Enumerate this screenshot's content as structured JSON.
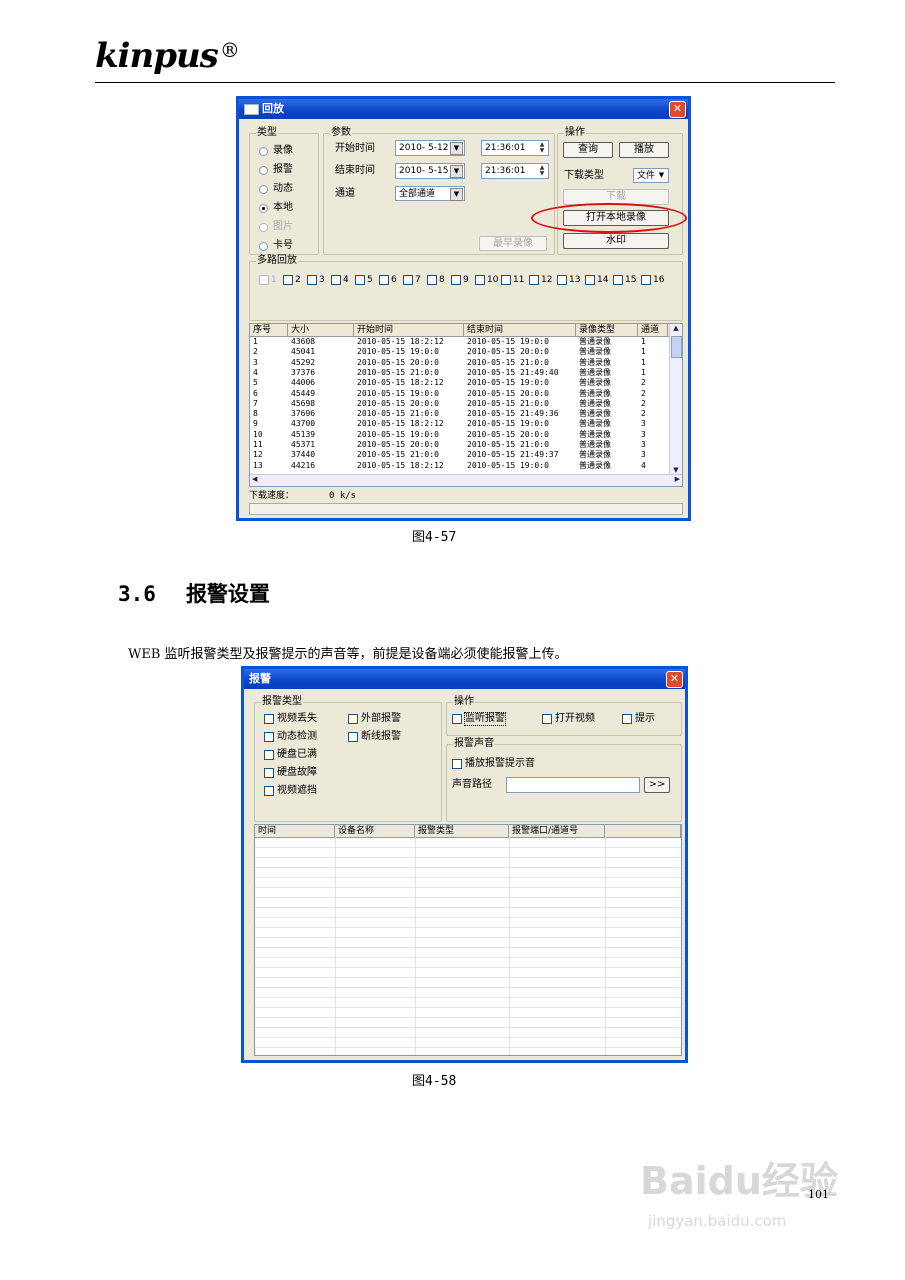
{
  "header": {
    "brand": "kinpus",
    "reg": "®"
  },
  "pb": {
    "title": "回放",
    "type_group": "类型",
    "types": [
      {
        "label": "录像",
        "on": false,
        "dis": false
      },
      {
        "label": "报警",
        "on": false,
        "dis": false
      },
      {
        "label": "动态",
        "on": false,
        "dis": false
      },
      {
        "label": "本地",
        "on": true,
        "dis": false
      },
      {
        "label": "图片",
        "on": false,
        "dis": true
      },
      {
        "label": "卡号",
        "on": false,
        "dis": false
      }
    ],
    "param_group": "参数",
    "start_label": "开始时间",
    "start_date": "2010- 5-12",
    "start_time": "21:36:01",
    "end_label": "结束时间",
    "end_date": "2010- 5-15",
    "end_time": "21:36:01",
    "channel_label": "通道",
    "channel_value": "全部通道",
    "earliest_btn": "最早录像",
    "op_group": "操作",
    "query_btn": "查询",
    "play_btn": "播放",
    "dl_type_label": "下载类型",
    "dl_type_value": "文件",
    "download_btn": "下载",
    "open_local_btn": "打开本地录像",
    "watermark_btn": "水印",
    "multi_group": "多路回放",
    "multi": [
      "1",
      "2",
      "3",
      "4",
      "5",
      "6",
      "7",
      "8",
      "9",
      "10",
      "11",
      "12",
      "13",
      "14",
      "15",
      "16"
    ],
    "columns": [
      "序号",
      "大小",
      "开始时间",
      "结束时间",
      "录像类型",
      "通道"
    ],
    "rows": [
      [
        "1",
        "43608",
        "2010-05-15 18:2:12",
        "2010-05-15 19:0:0",
        "普通录像",
        "1"
      ],
      [
        "2",
        "45041",
        "2010-05-15 19:0:0",
        "2010-05-15 20:0:0",
        "普通录像",
        "1"
      ],
      [
        "3",
        "45292",
        "2010-05-15 20:0:0",
        "2010-05-15 21:0:0",
        "普通录像",
        "1"
      ],
      [
        "4",
        "37376",
        "2010-05-15 21:0:0",
        "2010-05-15 21:49:40",
        "普通录像",
        "1"
      ],
      [
        "5",
        "44006",
        "2010-05-15 18:2:12",
        "2010-05-15 19:0:0",
        "普通录像",
        "2"
      ],
      [
        "6",
        "45449",
        "2010-05-15 19:0:0",
        "2010-05-15 20:0:0",
        "普通录像",
        "2"
      ],
      [
        "7",
        "45698",
        "2010-05-15 20:0:0",
        "2010-05-15 21:0:0",
        "普通录像",
        "2"
      ],
      [
        "8",
        "37696",
        "2010-05-15 21:0:0",
        "2010-05-15 21:49:36",
        "普通录像",
        "2"
      ],
      [
        "9",
        "43700",
        "2010-05-15 18:2:12",
        "2010-05-15 19:0:0",
        "普通录像",
        "3"
      ],
      [
        "10",
        "45139",
        "2010-05-15 19:0:0",
        "2010-05-15 20:0:0",
        "普通录像",
        "3"
      ],
      [
        "11",
        "45371",
        "2010-05-15 20:0:0",
        "2010-05-15 21:0:0",
        "普通录像",
        "3"
      ],
      [
        "12",
        "37440",
        "2010-05-15 21:0:0",
        "2010-05-15 21:49:37",
        "普通录像",
        "3"
      ],
      [
        "13",
        "44216",
        "2010-05-15 18:2:12",
        "2010-05-15 19:0:0",
        "普通录像",
        "4"
      ]
    ],
    "speed_label": "下载速度：",
    "speed_value": "0 k/s"
  },
  "caption1": "图4-57",
  "section": {
    "number": "3.6",
    "title": "报警设置"
  },
  "paragraph": "WEB 监听报警类型及报警提示的声音等，前提是设备端必须使能报警上传。",
  "al": {
    "title": "报警",
    "type_group": "报警类型",
    "types": [
      "视频丢失",
      "外部报警",
      "动态检测",
      "断线报警",
      "硬盘已满",
      "硬盘故障",
      "视频遮挡"
    ],
    "op_group": "操作",
    "ops": [
      "监听报警",
      "打开视频",
      "提示"
    ],
    "sound_group": "报警声音",
    "play_sound": "播放报警提示音",
    "path_label": "声音路径",
    "browse_btn": ">>",
    "columns": [
      "时间",
      "设备名称",
      "报警类型",
      "报警端口/通道号"
    ]
  },
  "caption2": "图4-58",
  "page_number": "101",
  "watermark": {
    "main": "Baidu经验",
    "sub": "jingyan.baidu.com"
  }
}
